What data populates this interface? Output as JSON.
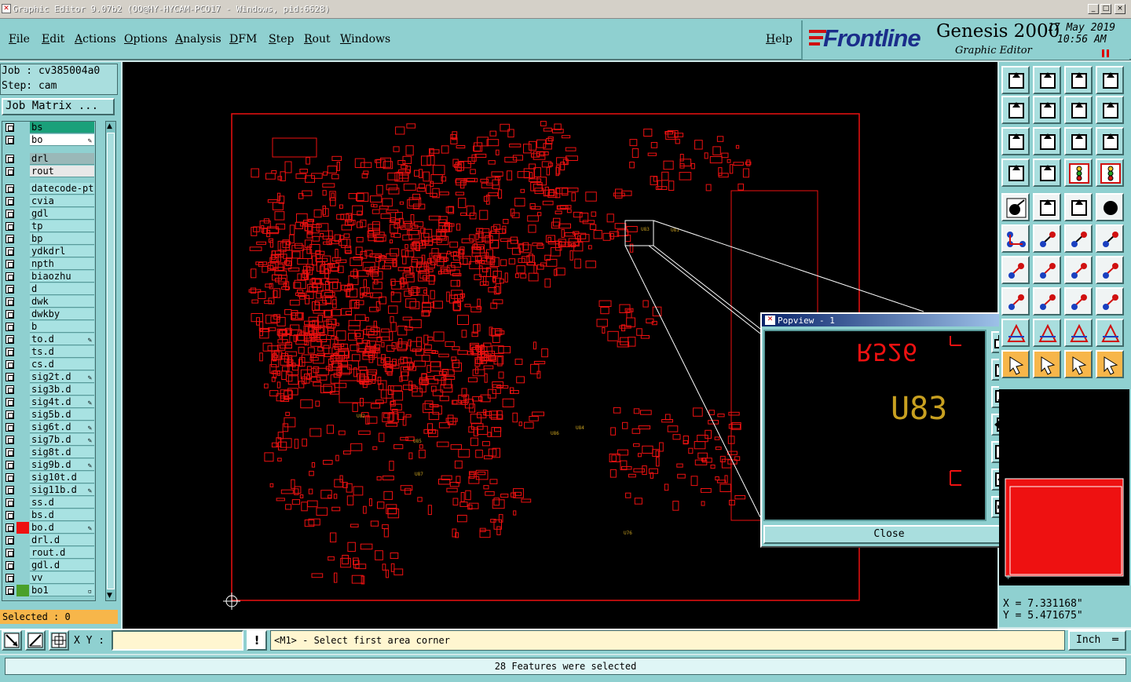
{
  "window": {
    "title": "Graphic Editor 9.07b2 (OO@HY-HYCAM-PCO17 - Windows, pid:6628)",
    "min_label": "_",
    "max_label": "□",
    "close_label": "×"
  },
  "menu": {
    "items": [
      "File",
      "Edit",
      "Actions",
      "Options",
      "Analysis",
      "DFM",
      "Step",
      "Rout",
      "Windows"
    ],
    "help": "Help"
  },
  "branding": {
    "logo": "Frontline",
    "product": "Genesis 2000",
    "subtitle": "Graphic Editor",
    "date": "17 May 2019",
    "time": "10:56 AM"
  },
  "job": {
    "job_label": "Job : cv385004a0",
    "step_label": "Step: cam",
    "matrix_button": "Job Matrix ..."
  },
  "layers": [
    {
      "name": "bs",
      "color": "#1aa07a",
      "edit": ""
    },
    {
      "name": "bo",
      "color": "#ffffff",
      "edit": "✎"
    },
    {
      "name": "drl",
      "color": "#9ab8b8",
      "edit": ""
    },
    {
      "name": "rout",
      "color": "#e8e8e8",
      "edit": ""
    },
    {
      "name": "datecode-pte",
      "color": "#a8e2e2",
      "edit": ""
    },
    {
      "name": "cvia",
      "color": "#a8e2e2",
      "edit": ""
    },
    {
      "name": "gdl",
      "color": "#a8e2e2",
      "edit": ""
    },
    {
      "name": "tp",
      "color": "#a8e2e2",
      "edit": ""
    },
    {
      "name": "bp",
      "color": "#a8e2e2",
      "edit": ""
    },
    {
      "name": "ydkdrl",
      "color": "#a8e2e2",
      "edit": ""
    },
    {
      "name": "npth",
      "color": "#a8e2e2",
      "edit": ""
    },
    {
      "name": "biaozhu",
      "color": "#a8e2e2",
      "edit": ""
    },
    {
      "name": "d",
      "color": "#a8e2e2",
      "edit": ""
    },
    {
      "name": "dwk",
      "color": "#a8e2e2",
      "edit": ""
    },
    {
      "name": "dwkby",
      "color": "#a8e2e2",
      "edit": ""
    },
    {
      "name": "b",
      "color": "#a8e2e2",
      "edit": ""
    },
    {
      "name": "to.d",
      "color": "#a8e2e2",
      "edit": "✎"
    },
    {
      "name": "ts.d",
      "color": "#a8e2e2",
      "edit": ""
    },
    {
      "name": "cs.d",
      "color": "#a8e2e2",
      "edit": ""
    },
    {
      "name": "sig2t.d",
      "color": "#a8e2e2",
      "edit": "✎"
    },
    {
      "name": "sig3b.d",
      "color": "#a8e2e2",
      "edit": ""
    },
    {
      "name": "sig4t.d",
      "color": "#a8e2e2",
      "edit": "✎"
    },
    {
      "name": "sig5b.d",
      "color": "#a8e2e2",
      "edit": ""
    },
    {
      "name": "sig6t.d",
      "color": "#a8e2e2",
      "edit": "✎"
    },
    {
      "name": "sig7b.d",
      "color": "#a8e2e2",
      "edit": "✎"
    },
    {
      "name": "sig8t.d",
      "color": "#a8e2e2",
      "edit": ""
    },
    {
      "name": "sig9b.d",
      "color": "#a8e2e2",
      "edit": "✎"
    },
    {
      "name": "sig10t.d",
      "color": "#a8e2e2",
      "edit": ""
    },
    {
      "name": "sig11b.d",
      "color": "#a8e2e2",
      "edit": "✎"
    },
    {
      "name": "ss.d",
      "color": "#a8e2e2",
      "edit": ""
    },
    {
      "name": "bs.d",
      "color": "#a8e2e2",
      "edit": ""
    },
    {
      "name": "bo.d",
      "color": "#a8e2e2",
      "edit": "✎",
      "swatch": "#ee1111"
    },
    {
      "name": "drl.d",
      "color": "#a8e2e2",
      "edit": ""
    },
    {
      "name": "rout.d",
      "color": "#a8e2e2",
      "edit": ""
    },
    {
      "name": "gdl.d",
      "color": "#a8e2e2",
      "edit": ""
    },
    {
      "name": "vv",
      "color": "#a8e2e2",
      "edit": ""
    },
    {
      "name": "bo1",
      "color": "#a8e2e2",
      "edit": "▫",
      "swatch": "#4aa02a"
    }
  ],
  "selection": {
    "label": "Selected : 0"
  },
  "board": {
    "component_labels": [
      "U83",
      "U81",
      "U84",
      "U86",
      "U85",
      "U87",
      "U82",
      "U76"
    ]
  },
  "popview": {
    "title": "Popview - 1",
    "component": "U83",
    "mirrored_text": "R526",
    "close_button": "Close"
  },
  "coords": {
    "x": "X = 7.331168\"",
    "y": "Y = 5.471675\""
  },
  "bottom": {
    "xy_label": "X Y :",
    "xy_value": "",
    "message": "<M1> - Select first area corner",
    "units": "Inch",
    "status": "28 Features were selected"
  },
  "colors": {
    "board": "#ee1111",
    "silk": "#c8a020",
    "panel": "#8fd0d0"
  }
}
